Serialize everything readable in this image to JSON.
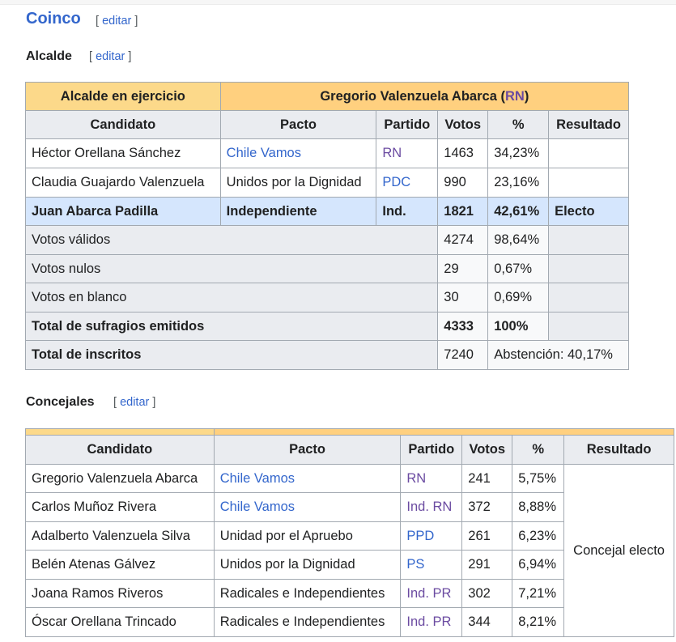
{
  "section": {
    "title": "Coinco",
    "edit_label": "editar"
  },
  "alcalde": {
    "heading": "Alcalde",
    "edit_label": "editar",
    "incumbent_label": "Alcalde en ejercicio",
    "incumbent_name": "Gregorio Valenzuela Abarca",
    "incumbent_party": "RN",
    "headers": [
      "Candidato",
      "Pacto",
      "Partido",
      "Votos",
      "%",
      "Resultado"
    ],
    "rows": [
      {
        "candidato": "Héctor Orellana Sánchez",
        "pacto": "Chile Vamos",
        "partido": "RN",
        "votos": "1463",
        "pct": "34,23%",
        "resultado": ""
      },
      {
        "candidato": "Claudia Guajardo Valenzuela",
        "pacto": "Unidos por la Dignidad",
        "partido": "PDC",
        "votos": "990",
        "pct": "23,16%",
        "resultado": ""
      },
      {
        "candidato": "Juan Abarca Padilla",
        "pacto": "Independiente",
        "partido": "Ind.",
        "votos": "1821",
        "pct": "42,61%",
        "resultado": "Electo"
      }
    ],
    "summary": [
      {
        "label": "Votos válidos",
        "votos": "4274",
        "pct": "98,64%"
      },
      {
        "label": "Votos nulos",
        "votos": "29",
        "pct": "0,67%"
      },
      {
        "label": "Votos en blanco",
        "votos": "30",
        "pct": "0,69%"
      },
      {
        "label": "Total de sufragios emitidos",
        "votos": "4333",
        "pct": "100%"
      },
      {
        "label": "Total de inscritos",
        "votos": "7240",
        "pct": "Abstención: 40,17%"
      }
    ]
  },
  "concejales": {
    "heading": "Concejales",
    "edit_label": "editar",
    "headers": [
      "Candidato",
      "Pacto",
      "Partido",
      "Votos",
      "%",
      "Resultado"
    ],
    "resultado": "Concejal electo",
    "rows": [
      {
        "candidato": "Gregorio Valenzuela Abarca",
        "pacto": "Chile Vamos",
        "partido": "RN",
        "votos": "241",
        "pct": "5,75%"
      },
      {
        "candidato": "Carlos Muñoz Rivera",
        "pacto": "Chile Vamos",
        "partido": "Ind. RN",
        "votos": "372",
        "pct": "8,88%"
      },
      {
        "candidato": "Adalberto Valenzuela Silva",
        "pacto": "Unidad por el Apruebo",
        "partido": "PPD",
        "votos": "261",
        "pct": "6,23%"
      },
      {
        "candidato": "Belén Atenas Gálvez",
        "pacto": "Unidos por la Dignidad",
        "partido": "PS",
        "votos": "291",
        "pct": "6,94%"
      },
      {
        "candidato": "Joana Ramos Riveros",
        "pacto": "Radicales e Independientes",
        "partido": "Ind. PR",
        "votos": "302",
        "pct": "7,21%"
      },
      {
        "candidato": "Óscar Orellana Trincado",
        "pacto": "Radicales e Independientes",
        "partido": "Ind. PR",
        "votos": "344",
        "pct": "8,21%"
      }
    ]
  },
  "colors": {
    "link": "#3366cc",
    "party": "#6b4ba1",
    "header_bg": "#eaecf0",
    "incumbent_bg": "#fcd98a",
    "elected_bg": "#d5e6fd"
  }
}
